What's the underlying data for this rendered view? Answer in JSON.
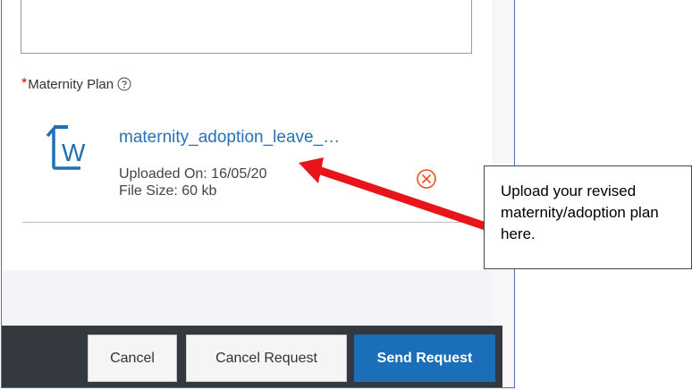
{
  "form": {
    "field_required_marker": "*",
    "field_label": "Maternity Plan",
    "help_icon": "question-circle-icon"
  },
  "attachment": {
    "file_icon": "word-document-icon",
    "file_name": "maternity_adoption_leave_…",
    "uploaded_on_label": "Uploaded On: 16/05/20",
    "file_size_label": "File Size: 60 kb",
    "remove_icon": "close-circle-icon"
  },
  "footer": {
    "cancel_label": "Cancel",
    "cancel_request_label": "Cancel Request",
    "send_request_label": "Send Request"
  },
  "annotation": {
    "text": "Upload your revised maternity/adoption plan here."
  },
  "colors": {
    "required": "#d40000",
    "link": "#2a6fb3",
    "primary_button": "#1b6fb9",
    "footer_bar": "#33393f",
    "remove_icon": "#e8501e",
    "arrow": "#e8141a"
  }
}
